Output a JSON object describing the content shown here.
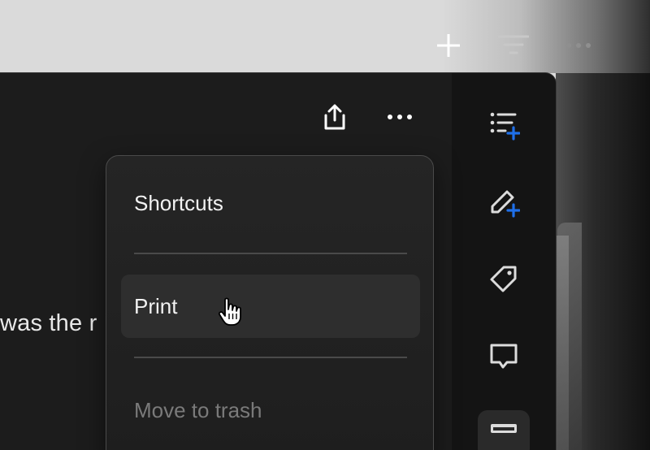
{
  "body": {
    "text": "was the r"
  },
  "menu": {
    "items": [
      {
        "label": "Shortcuts",
        "state": "normal"
      },
      {
        "label": "Print",
        "state": "hover"
      },
      {
        "label": "Move to trash",
        "state": "disabled"
      }
    ]
  },
  "icons": {
    "top_toolbar": [
      "plus-icon",
      "filter-icon",
      "more-horizontal-icon"
    ],
    "header": [
      "share-icon",
      "more-horizontal-icon"
    ],
    "sidebar": [
      "add-list-icon",
      "add-edit-icon",
      "tag-icon",
      "comment-icon",
      "archive-icon"
    ]
  },
  "colors": {
    "accent": "#1f6fe8",
    "panel": "#1c1c1c",
    "sidebar": "#141414",
    "menu_bg": "#222222",
    "muted_text": "#7a7a7a"
  }
}
